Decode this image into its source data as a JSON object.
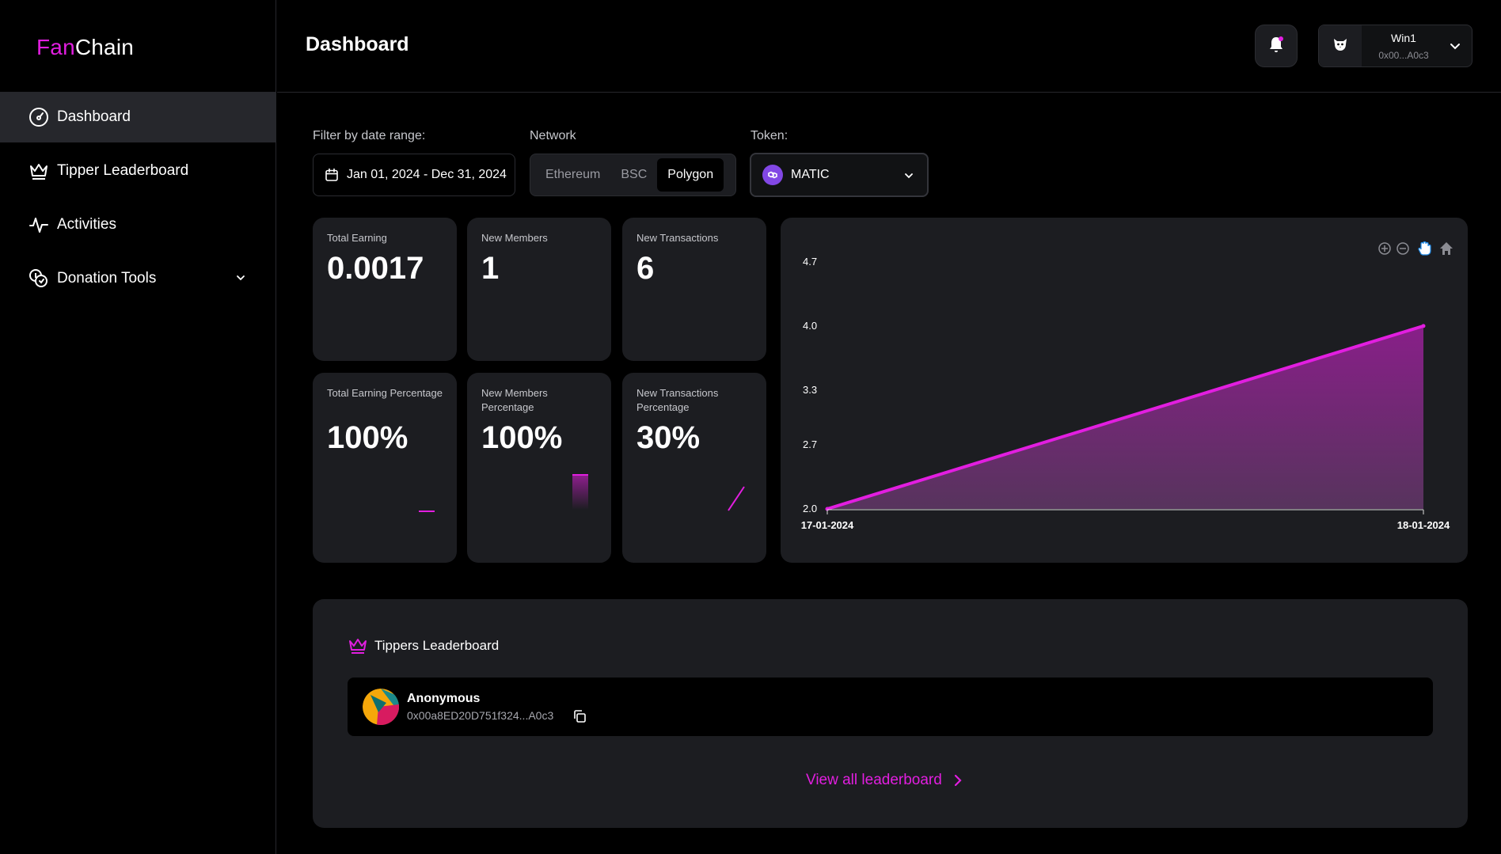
{
  "app": {
    "logo_part1": "Fan",
    "logo_part2": "Chain",
    "accent": "#e21ee0"
  },
  "sidebar": {
    "items": [
      {
        "label": "Dashboard",
        "icon": "gauge-icon",
        "active": true
      },
      {
        "label": "Tipper Leaderboard",
        "icon": "crown-icon"
      },
      {
        "label": "Activities",
        "icon": "activity-icon"
      },
      {
        "label": "Donation Tools",
        "icon": "coins-icon",
        "expandable": true
      }
    ]
  },
  "header": {
    "title": "Dashboard",
    "notifications_icon": "bell-icon",
    "wallet": {
      "name": "Win1",
      "address": "0x00...A0c3"
    }
  },
  "filters": {
    "date_label": "Filter by date range:",
    "date_value": "Jan 01, 2024 - Dec 31, 2024",
    "network_label": "Network",
    "networks": [
      "Ethereum",
      "BSC",
      "Polygon"
    ],
    "network_selected": "Polygon",
    "token_label": "Token:",
    "token_value": "MATIC"
  },
  "stats": [
    {
      "label": "Total Earning",
      "value": "0.0017"
    },
    {
      "label": "New Members",
      "value": "1"
    },
    {
      "label": "New Transactions",
      "value": "6"
    },
    {
      "label": "Total Earning Percentage",
      "value": "100%"
    },
    {
      "label": "New Members Percentage",
      "value": "100%"
    },
    {
      "label": "New Transactions Percentage",
      "value": "30%"
    }
  ],
  "chart_data": {
    "type": "area",
    "x": [
      "17-01-2024",
      "18-01-2024"
    ],
    "values": [
      2.0,
      4.0
    ],
    "y_ticks": [
      2.0,
      2.7,
      3.3,
      4.0,
      4.7
    ],
    "ylim": [
      2.0,
      4.7
    ],
    "color": "#e21ee0",
    "toolbar": [
      "zoom-in-icon",
      "zoom-out-icon",
      "pan-hand-icon",
      "home-icon"
    ]
  },
  "leaderboard": {
    "title": "Tippers Leaderboard",
    "rows": [
      {
        "name": "Anonymous",
        "address": "0x00a8ED20D751f324...A0c3"
      }
    ],
    "view_all": "View all leaderboard"
  }
}
